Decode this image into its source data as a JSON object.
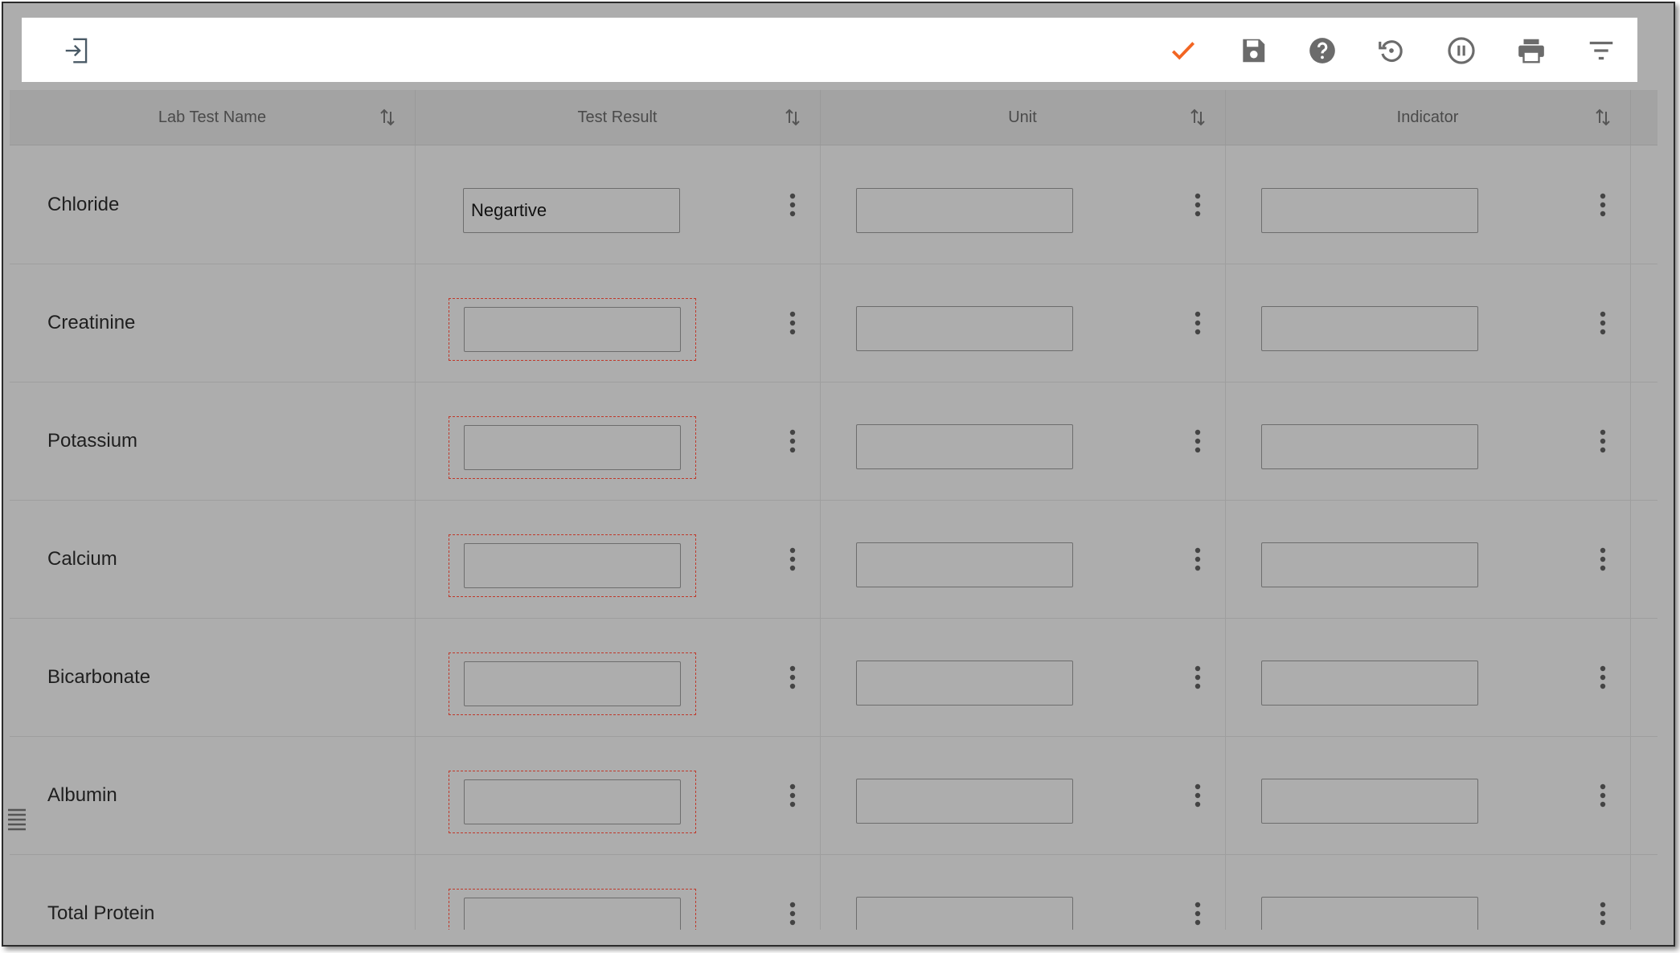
{
  "toolbar": {
    "icons": [
      "sign-in-icon",
      "check-icon",
      "save-icon",
      "help-icon",
      "reset-icon",
      "pause-icon",
      "print-icon",
      "filter-icon"
    ],
    "accent_color": "#f26522"
  },
  "table": {
    "columns": [
      "Lab Test Name",
      "Test Result",
      "Unit",
      "Indicator"
    ],
    "rows": [
      {
        "name": "Chloride",
        "result": "Negartive",
        "unit": "",
        "indicator": ""
      },
      {
        "name": "Creatinine",
        "result": "",
        "unit": "",
        "indicator": ""
      },
      {
        "name": "Potassium",
        "result": "",
        "unit": "",
        "indicator": ""
      },
      {
        "name": "Calcium",
        "result": "",
        "unit": "",
        "indicator": ""
      },
      {
        "name": "Bicarbonate",
        "result": "",
        "unit": "",
        "indicator": ""
      },
      {
        "name": "Albumin",
        "result": "",
        "unit": "",
        "indicator": ""
      },
      {
        "name": "Total Protein",
        "result": "",
        "unit": "",
        "indicator": ""
      }
    ]
  }
}
